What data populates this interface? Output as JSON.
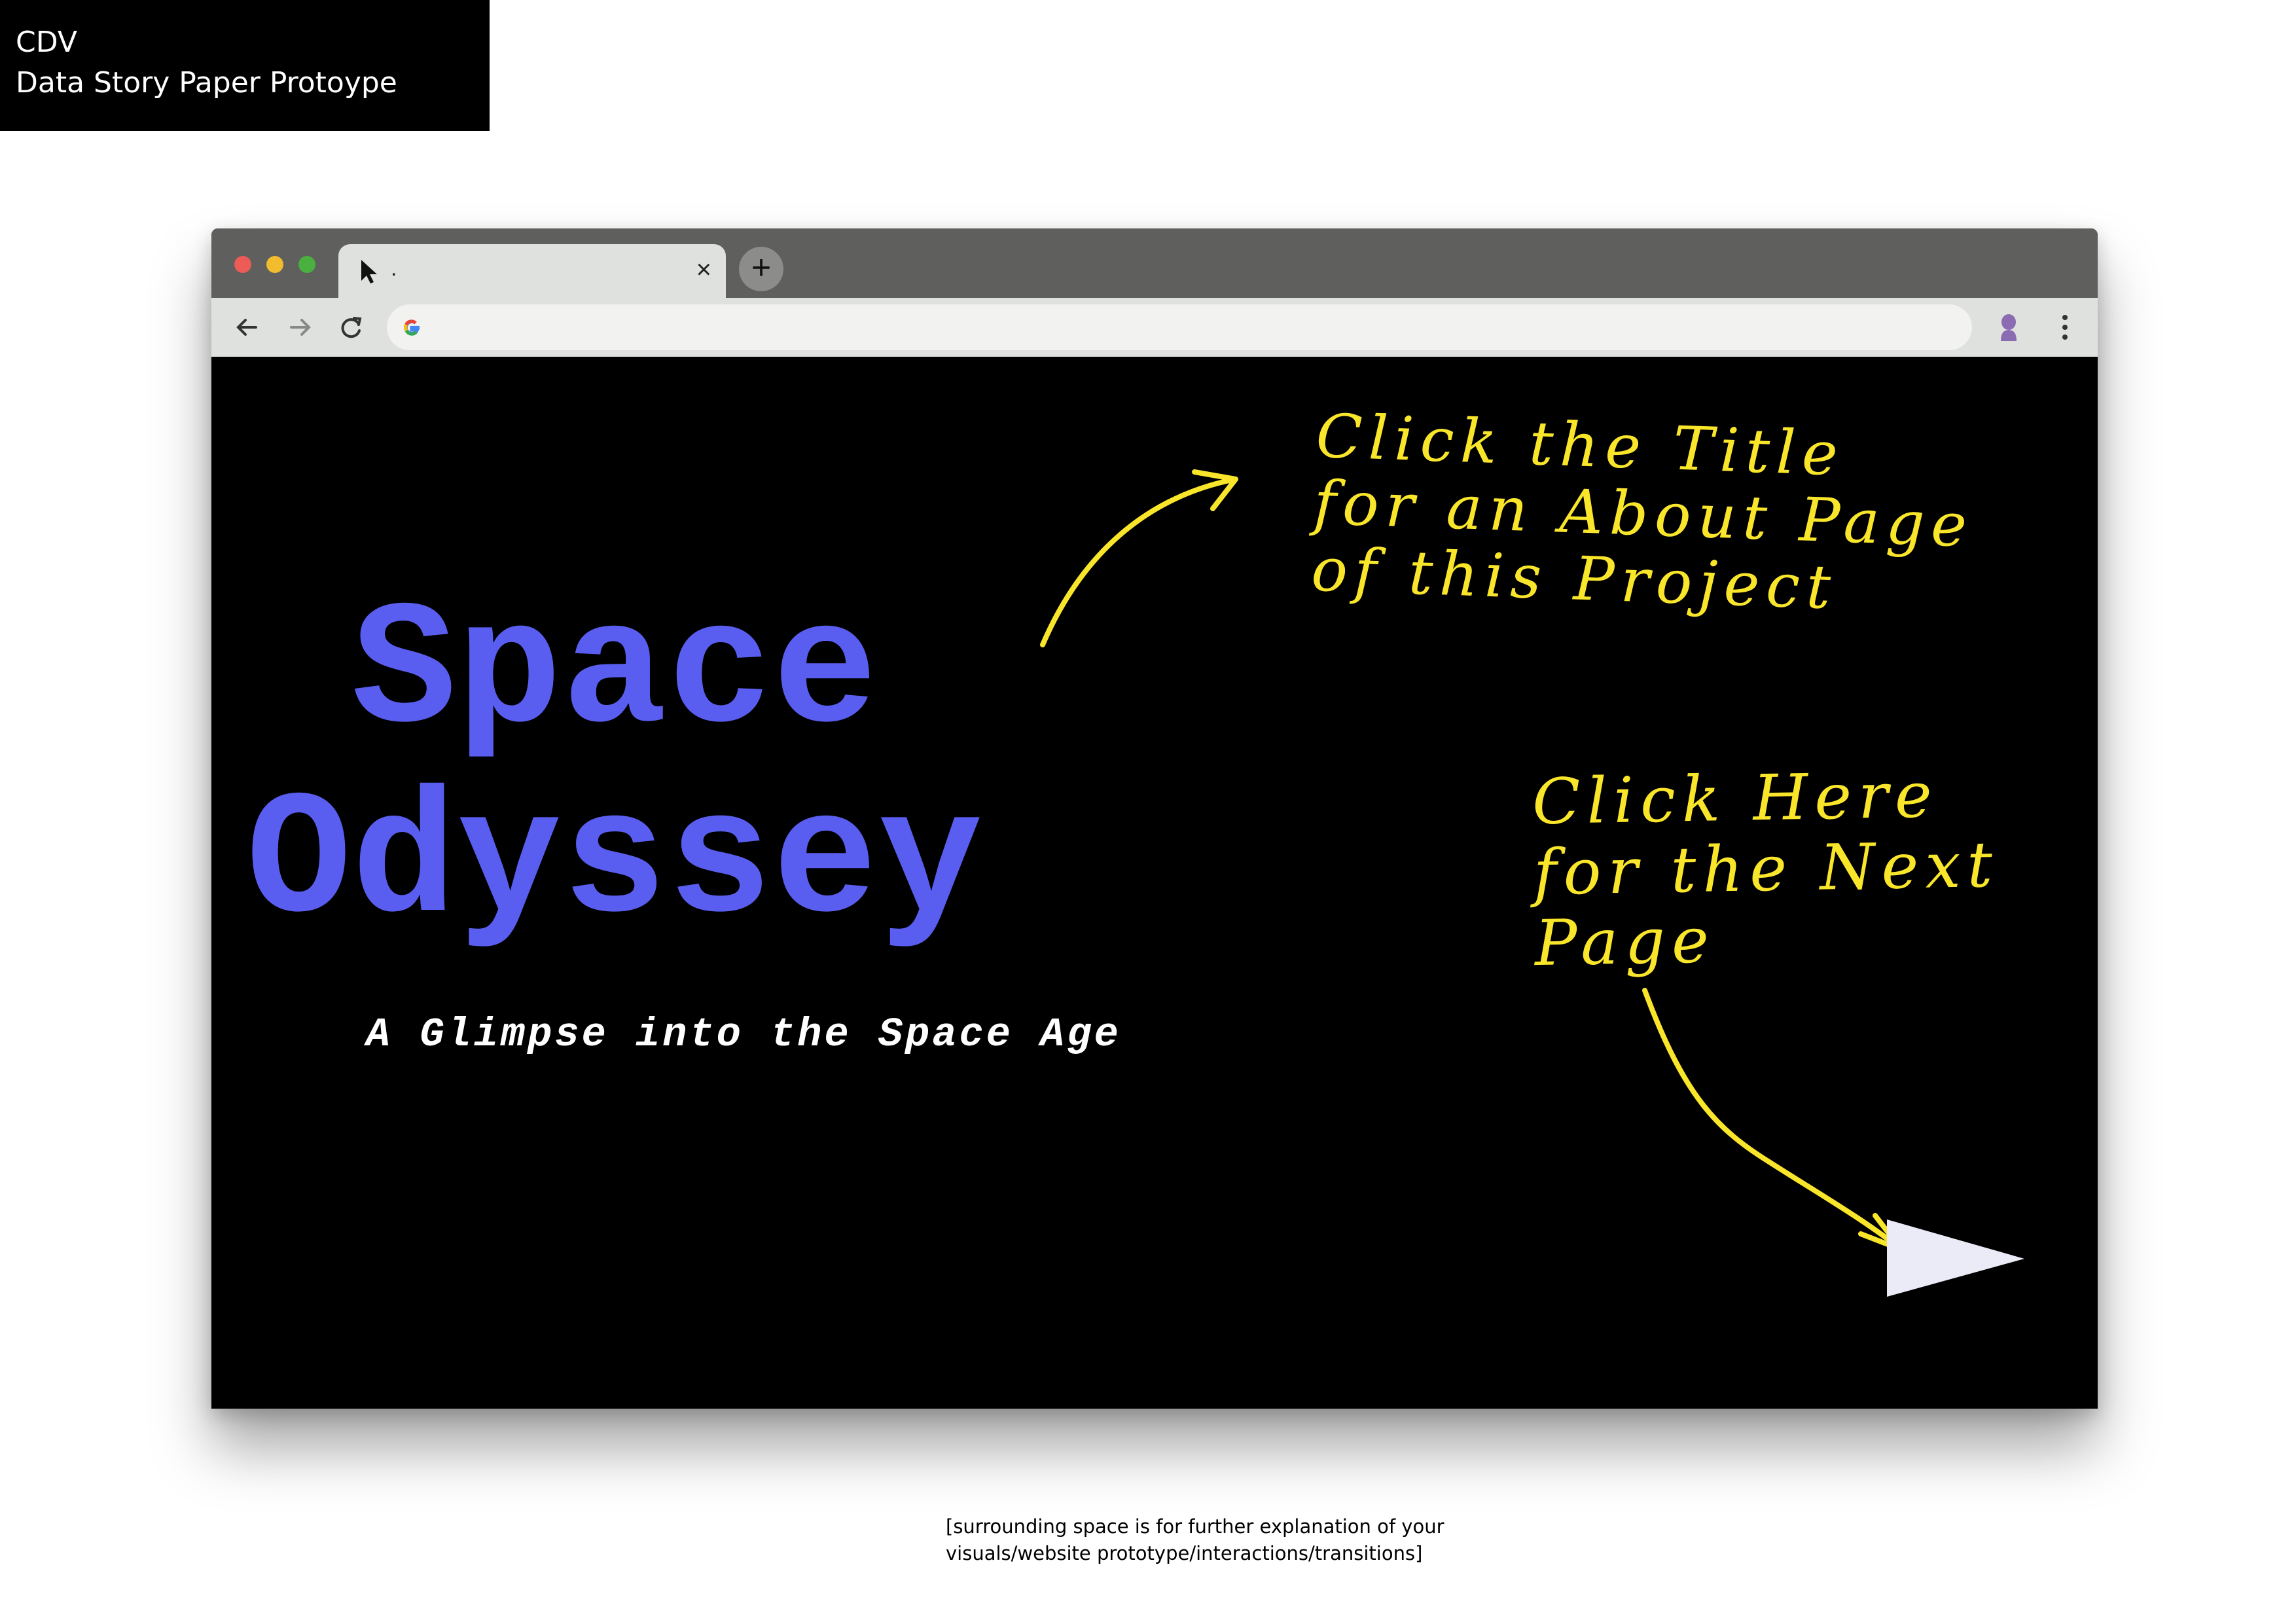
{
  "label": {
    "course": "CDV",
    "project": "Data Story Paper Protoype"
  },
  "browser": {
    "tab_title": ".",
    "tab_close": "×",
    "new_tab": "+",
    "address_value": "",
    "icons": [
      "close-icon",
      "plus-icon",
      "back-arrow-icon",
      "forward-arrow-icon",
      "reload-icon",
      "google-icon",
      "profile-icon",
      "more-menu-icon",
      "cursor-icon"
    ],
    "traffic_colors": {
      "red": "#ec5b55",
      "yellow": "#f1bc2e",
      "green": "#4ab03f"
    }
  },
  "page": {
    "title_line1": "Space",
    "title_line2": "Odyssey",
    "subtitle": "A Glimpse into the Space Age",
    "title_color": "#5a5ef0",
    "background": "#000000"
  },
  "annotations": {
    "title_note": [
      "Click the Title",
      "for an About Page",
      "of this Project"
    ],
    "next_note": [
      "Click Here",
      "for the Next",
      "Page"
    ],
    "color": "#f9e62b"
  },
  "footer": {
    "line1": "[surrounding space is for further explanation of your",
    "line2": "visuals/website prototype/interactions/transitions]"
  }
}
